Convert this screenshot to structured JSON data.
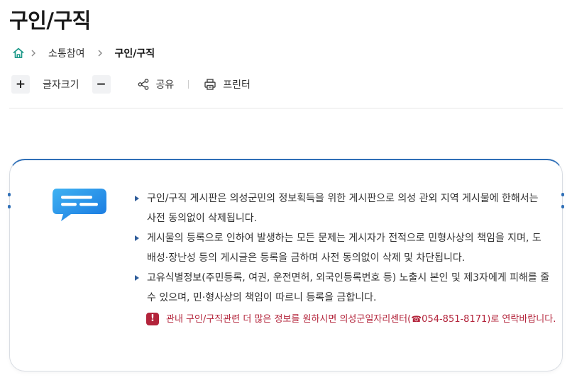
{
  "page": {
    "title": "구인/구직"
  },
  "breadcrumb": {
    "home_icon": "home-icon",
    "items": [
      {
        "label": "소통참여"
      },
      {
        "label": "구인/구직"
      }
    ]
  },
  "toolbar": {
    "increase_label": "+",
    "font_size_label": "글자크기",
    "decrease_label": "−",
    "share_label": "공유",
    "print_label": "프린터"
  },
  "notice": {
    "icon": "chat-bubble-icon",
    "items": [
      {
        "text": "구인/구직 게시판은 의성군민의 정보획득을 위한 게시판으로 의성 관외 지역 게시물에 한해서는 사전 동의없이 삭제됩니다."
      },
      {
        "text": "게시물의 등록으로 인하여 발생하는 모든 문제는 게시자가 전적으로 민형사상의 책임을 지며, 도배성·장난성 등의 게시글은 등록을 금하며 사전 동의없이 삭제 및 차단됩니다."
      },
      {
        "text": "고유식별정보(주민등록, 여권, 운전면허, 외국인등록번호 등) 노출시 본인 및 제3자에게 피해를 줄 수 있으며, 민·형사상의 책임이 따르니 등록을 금합니다."
      }
    ],
    "alert": {
      "icon_text": "!",
      "text_before": "관내 구인/구직관련 더 많은 정보를 원하시면 의성군일자리센터(",
      "phone_icon": "☎",
      "phone": "054-851-8171",
      "text_after": ")로 연락바랍니다."
    }
  },
  "colors": {
    "accent_blue": "#2f6fb7",
    "alert_red": "#b3243b",
    "home_green": "#1f9a8a"
  }
}
